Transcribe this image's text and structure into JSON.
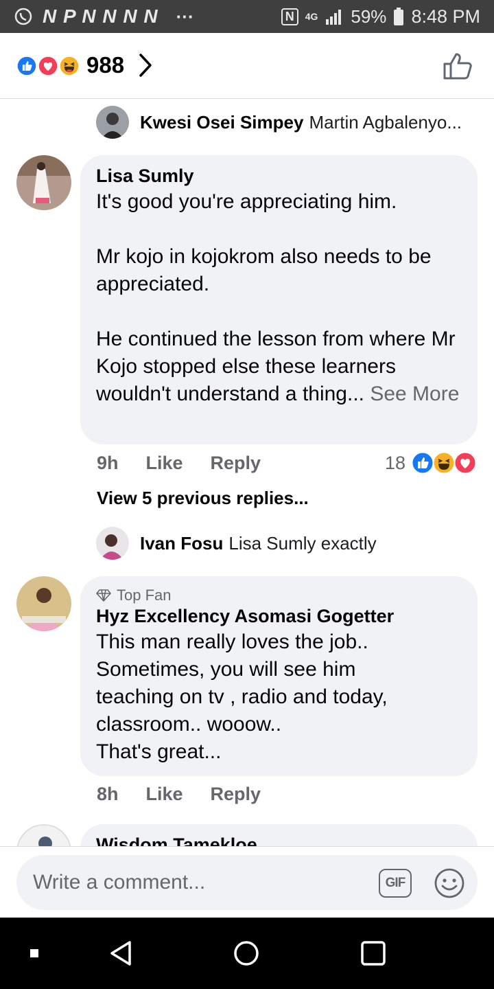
{
  "status_bar": {
    "left_icons": [
      "whatsapp-icon",
      "notification-n-icon",
      "pinterest-icon",
      "notification-n-icon",
      "notification-n-icon",
      "notification-n-icon",
      "notification-n-icon"
    ],
    "notif_letters": "N P N N N N",
    "more": "···",
    "network": "4G",
    "battery": "59%",
    "time": "8:48 PM"
  },
  "reactions": {
    "count": "988",
    "icons": [
      "like-reaction-icon",
      "love-reaction-icon",
      "haha-reaction-icon"
    ],
    "colors": {
      "like": "#1877f2",
      "love": "#f33e58",
      "haha": "#f7b125"
    }
  },
  "comments": [
    {
      "type": "reply",
      "name": "Kwesi Osei Simpey",
      "text": "Martin Agbalenyo..."
    },
    {
      "type": "comment",
      "name": "Lisa Sumly",
      "paragraphs": [
        "It's good you're appreciating him.",
        "Mr kojo in kojokrom also needs to be appreciated.",
        "He continued the lesson from where Mr Kojo stopped else these learners wouldn't understand a thing..."
      ],
      "see_more": "See More",
      "time": "9h",
      "like": "Like",
      "reply": "Reply",
      "reaction_count": "18"
    },
    {
      "type": "view_previous",
      "text": "View 5 previous replies..."
    },
    {
      "type": "reply",
      "name": "Ivan Fosu",
      "text": "Lisa Sumly exactly"
    },
    {
      "type": "comment",
      "badge": "Top Fan",
      "name": "Hyz Excellency Asomasi Gogetter",
      "lines": [
        "This man really loves the job..",
        "Sometimes, you will see him",
        "teaching on tv , radio and today,",
        "classroom.. wooow..",
        "That's great..."
      ],
      "time": "8h",
      "like": "Like",
      "reply": "Reply"
    },
    {
      "type": "comment_partial",
      "name": "Wisdom Tamekloe"
    }
  ],
  "composer": {
    "placeholder": "Write a comment...",
    "gif_label": "GIF"
  }
}
